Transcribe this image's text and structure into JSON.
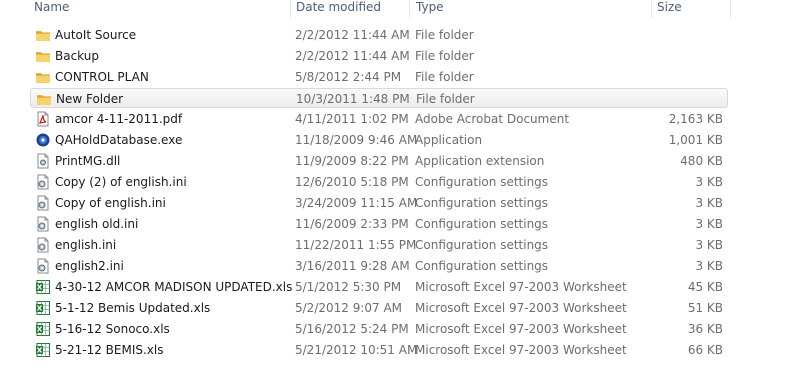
{
  "columns": {
    "name": "Name",
    "date_modified": "Date modified",
    "type": "Type",
    "size": "Size"
  },
  "files": [
    {
      "name": "AutoIt Source",
      "date": "2/2/2012 11:44 AM",
      "type": "File folder",
      "size": "",
      "icon": "folder-icon"
    },
    {
      "name": "Backup",
      "date": "2/2/2012 11:44 AM",
      "type": "File folder",
      "size": "",
      "icon": "folder-icon"
    },
    {
      "name": "CONTROL PLAN",
      "date": "5/8/2012 2:44 PM",
      "type": "File folder",
      "size": "",
      "icon": "folder-icon"
    },
    {
      "name": "New Folder",
      "date": "10/3/2011 1:48 PM",
      "type": "File folder",
      "size": "",
      "icon": "folder-icon",
      "selected": true
    },
    {
      "name": "amcor  4-11-2011.pdf",
      "date": "4/11/2011 1:02 PM",
      "type": "Adobe Acrobat Document",
      "size": "2,163 KB",
      "icon": "pdf-icon"
    },
    {
      "name": "QAHoldDatabase.exe",
      "date": "11/18/2009 9:46 AM",
      "type": "Application",
      "size": "1,001 KB",
      "icon": "application-icon"
    },
    {
      "name": "PrintMG.dll",
      "date": "11/9/2009 8:22 PM",
      "type": "Application extension",
      "size": "480 KB",
      "icon": "dll-icon"
    },
    {
      "name": "Copy (2) of english.ini",
      "date": "12/6/2010 5:18 PM",
      "type": "Configuration settings",
      "size": "3 KB",
      "icon": "ini-icon"
    },
    {
      "name": "Copy of english.ini",
      "date": "3/24/2009 11:15 AM",
      "type": "Configuration settings",
      "size": "3 KB",
      "icon": "ini-icon"
    },
    {
      "name": "english old.ini",
      "date": "11/6/2009 2:33 PM",
      "type": "Configuration settings",
      "size": "3 KB",
      "icon": "ini-icon"
    },
    {
      "name": "english.ini",
      "date": "11/22/2011 1:55 PM",
      "type": "Configuration settings",
      "size": "3 KB",
      "icon": "ini-icon"
    },
    {
      "name": "english2.ini",
      "date": "3/16/2011 9:28 AM",
      "type": "Configuration settings",
      "size": "3 KB",
      "icon": "ini-icon"
    },
    {
      "name": "4-30-12 AMCOR MADISON UPDATED.xls",
      "date": "5/1/2012 5:30 PM",
      "type": "Microsoft Excel 97-2003 Worksheet",
      "size": "45 KB",
      "icon": "excel-icon"
    },
    {
      "name": "5-1-12 Bemis Updated.xls",
      "date": "5/2/2012 9:07 AM",
      "type": "Microsoft Excel 97-2003 Worksheet",
      "size": "51 KB",
      "icon": "excel-icon"
    },
    {
      "name": "5-16-12 Sonoco.xls",
      "date": "5/16/2012 5:24 PM",
      "type": "Microsoft Excel 97-2003 Worksheet",
      "size": "36 KB",
      "icon": "excel-icon"
    },
    {
      "name": "5-21-12 BEMIS.xls",
      "date": "5/21/2012 10:51 AM",
      "type": "Microsoft Excel 97-2003 Worksheet",
      "size": "66 KB",
      "icon": "excel-icon"
    }
  ]
}
